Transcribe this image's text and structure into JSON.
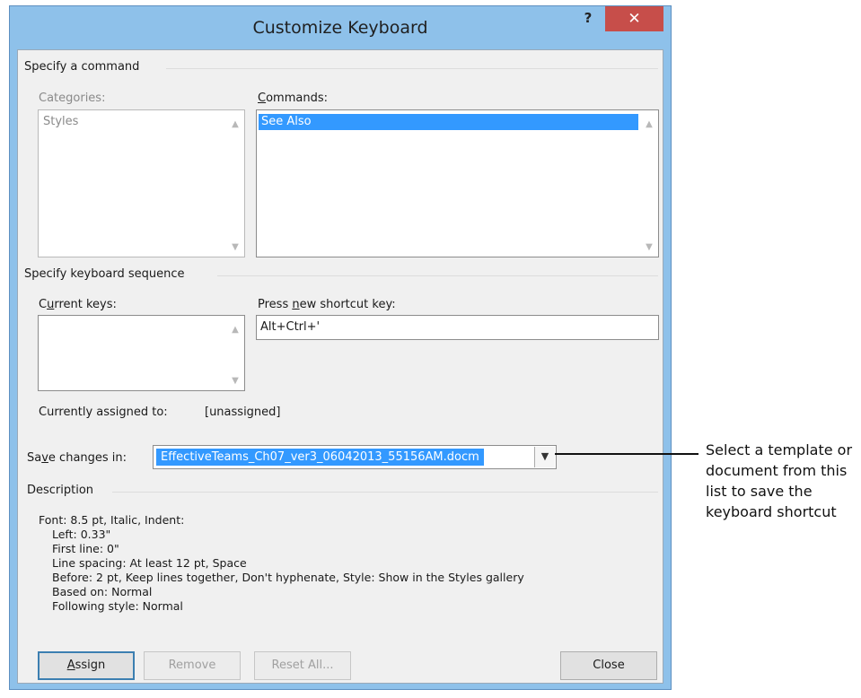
{
  "window": {
    "title": "Customize Keyboard",
    "help_label": "?",
    "close_label": "✕"
  },
  "specify_command": {
    "group_label": "Specify a command",
    "categories_label": "Categories:",
    "categories_items": [
      "Styles"
    ],
    "commands_label": "Commands:",
    "commands_items": [
      "See Also"
    ],
    "commands_selected": "See Also"
  },
  "keyboard_sequence": {
    "group_label": "Specify keyboard sequence",
    "current_keys_label": "Current keys:",
    "current_keys_items": [],
    "new_shortcut_label": "Press new shortcut key:",
    "new_shortcut_value": "Alt+Ctrl+'",
    "assigned_label": "Currently assigned to:",
    "assigned_value": "[unassigned]"
  },
  "save_changes": {
    "label": "Save changes in:",
    "selected_value": "EffectiveTeams_Ch07_ver3_06042013_55156AM.docm"
  },
  "description": {
    "group_label": "Description",
    "lines": [
      "Font: 8.5 pt, Italic, Indent:",
      "Left:  0.33\"",
      "First line:  0\"",
      "Line spacing:  At least 12 pt, Space",
      "Before:  2 pt, Keep lines together, Don't hyphenate, Style: Show in the Styles gallery",
      "Based on: Normal",
      "Following style: Normal"
    ]
  },
  "buttons": {
    "assign": "Assign",
    "remove": "Remove",
    "reset_all": "Reset All...",
    "close": "Close"
  },
  "callout": {
    "text": "Select a template or document from this list to save the keyboard shortcut"
  }
}
